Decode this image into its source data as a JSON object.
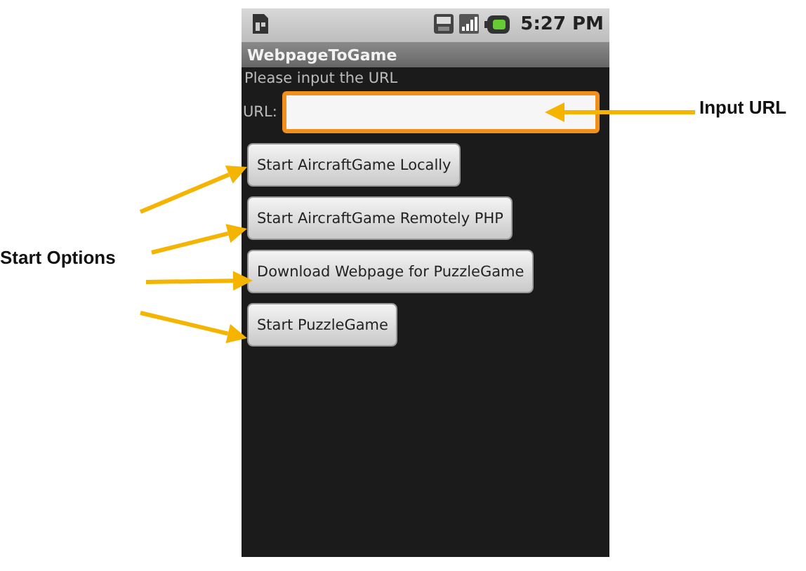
{
  "status_bar": {
    "time": "5:27 PM"
  },
  "app_bar": {
    "title": "WebpageToGame"
  },
  "prompt": "Please input the URL",
  "url_field": {
    "label": "URL:",
    "focused": true
  },
  "buttons": [
    {
      "label": "Start AircraftGame Locally"
    },
    {
      "label": "Start AircraftGame Remotely PHP"
    },
    {
      "label": "Download Webpage for PuzzleGame"
    },
    {
      "label": "Start PuzzleGame"
    }
  ],
  "annotations": [
    {
      "kind": "input",
      "label": "Input URL"
    },
    {
      "kind": "options",
      "label": "Start Options"
    }
  ]
}
